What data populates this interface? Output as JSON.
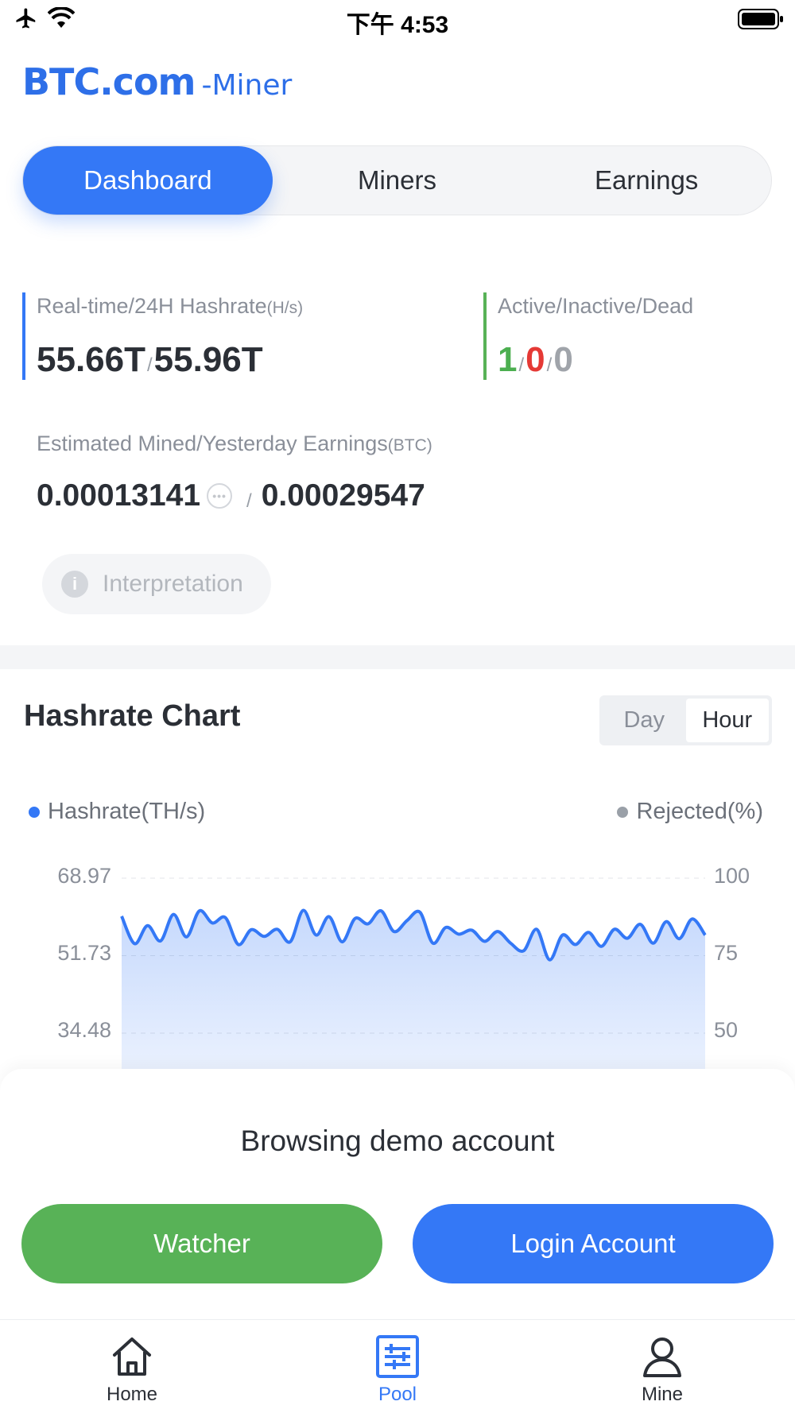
{
  "status_bar": {
    "time": "下午 4:53"
  },
  "logo": {
    "main": "BTC.com",
    "sub": "-Miner"
  },
  "tabs": [
    {
      "label": "Dashboard",
      "active": true
    },
    {
      "label": "Miners",
      "active": false
    },
    {
      "label": "Earnings",
      "active": false
    }
  ],
  "hashrate": {
    "label": "Real-time/24H Hashrate",
    "unit": "(H/s)",
    "realtime": "55.66T",
    "separator": "/",
    "day": "55.96T"
  },
  "miner_status": {
    "label": "Active/Inactive/Dead",
    "active": "1",
    "inactive": "0",
    "dead": "0",
    "separator": "/"
  },
  "earnings": {
    "label": "Estimated Mined/Yesterday Earnings",
    "unit": "(BTC)",
    "estimated": "0.00013141",
    "separator": "/",
    "yesterday": "0.00029547"
  },
  "interpretation": {
    "label": "Interpretation"
  },
  "chart_section": {
    "title": "Hashrate Chart",
    "range_options": [
      {
        "label": "Day",
        "active": false
      },
      {
        "label": "Hour",
        "active": true
      }
    ],
    "legend_left": "Hashrate(TH/s)",
    "legend_right": "Rejected(%)",
    "colors": {
      "hashrate": "#3478f6",
      "rejected": "#9aa0a8"
    }
  },
  "chart_data": {
    "type": "area",
    "ylabel_left": "",
    "ylabel_right": "",
    "y_left_ticks": [
      "68.97",
      "51.73",
      "34.48"
    ],
    "y_right_ticks": [
      "100",
      "75",
      "50"
    ],
    "ylim": [
      34.48,
      68.97
    ],
    "series": [
      {
        "name": "Hashrate(TH/s)",
        "values": [
          60.5,
          54.4,
          58.4,
          55.0,
          60.9,
          55.9,
          61.7,
          59.0,
          60.2,
          54.2,
          57.5,
          56.0,
          57.6,
          54.8,
          61.8,
          56.3,
          60.4,
          54.8,
          60.0,
          58.8,
          61.7,
          57.1,
          59.5,
          61.4,
          54.5,
          58.0,
          56.5,
          57.4,
          54.9,
          57.1,
          54.5,
          52.8,
          57.6,
          50.8,
          56.3,
          54.2,
          56.9,
          53.8,
          57.6,
          55.6,
          58.7,
          54.5,
          59.3,
          55.5,
          59.9,
          56.3
        ]
      }
    ],
    "grid": true,
    "legend_placement": "top"
  },
  "sheet": {
    "title": "Browsing demo account",
    "watch_button": "Watcher",
    "login_button": "Login Account"
  },
  "tabbar": [
    {
      "label": "Home",
      "icon": "home-icon",
      "active": false
    },
    {
      "label": "Pool",
      "icon": "pool-icon",
      "active": true
    },
    {
      "label": "Mine",
      "icon": "user-icon",
      "active": false
    }
  ]
}
